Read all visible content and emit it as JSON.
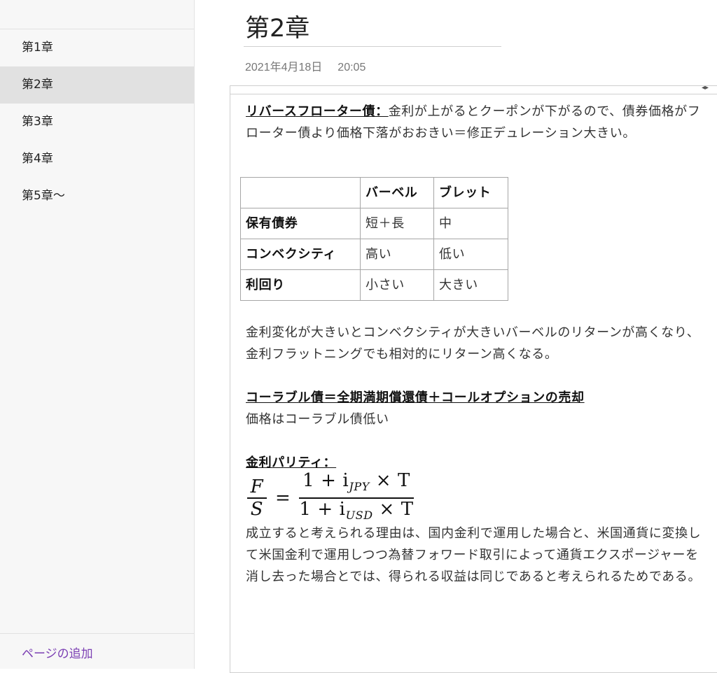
{
  "sidebar": {
    "pages": [
      "第1章",
      "第2章",
      "第3章",
      "第4章",
      "第5章～"
    ],
    "selected_index": 1,
    "add_page_label": "ページの追加"
  },
  "page": {
    "title": "第2章",
    "date": "2021年4月18日",
    "time": "20:05"
  },
  "content": {
    "para1_heading": "リバースフローター債：",
    "para1_text": "金利が上がるとクーポンが下がるので、債券価格がフローター債より価格下落がおおきい＝修正デュレーション大きい。",
    "table": {
      "headers": [
        "",
        "バーベル",
        "ブレット"
      ],
      "rows": [
        [
          "保有債券",
          "短＋長",
          "中"
        ],
        [
          "コンベクシティ",
          "高い",
          "低い"
        ],
        [
          "利回り",
          "小さい",
          "大きい"
        ]
      ]
    },
    "para2": "金利変化が大きいとコンベクシティが大きいバーベルのリターンが高くなり、金利フラットニングでも相対的にリターン高くなる。",
    "para3_heading": "コーラブル債＝全期満期償還債＋コールオプションの売却",
    "para3_text": "価格はコーラブル債低い",
    "para4_heading": "金利パリティ：",
    "formula": {
      "lhs_num": "F",
      "lhs_den": "S",
      "equals": "=",
      "rhs_num": "1 + i",
      "rhs_num_sub": "JPY",
      "rhs_num_tail": " × T",
      "rhs_den": "1 + i",
      "rhs_den_sub": "USD",
      "rhs_den_tail": " × T"
    },
    "para4_text": "成立すると考えられる理由は、国内金利で運用した場合と、米国通貨に変換して米国金利で運用しつつ為替フォワード取引によって通貨エクスポージャーを消し去った場合とでは、得られる収益は同じであると考えられるためである。"
  }
}
